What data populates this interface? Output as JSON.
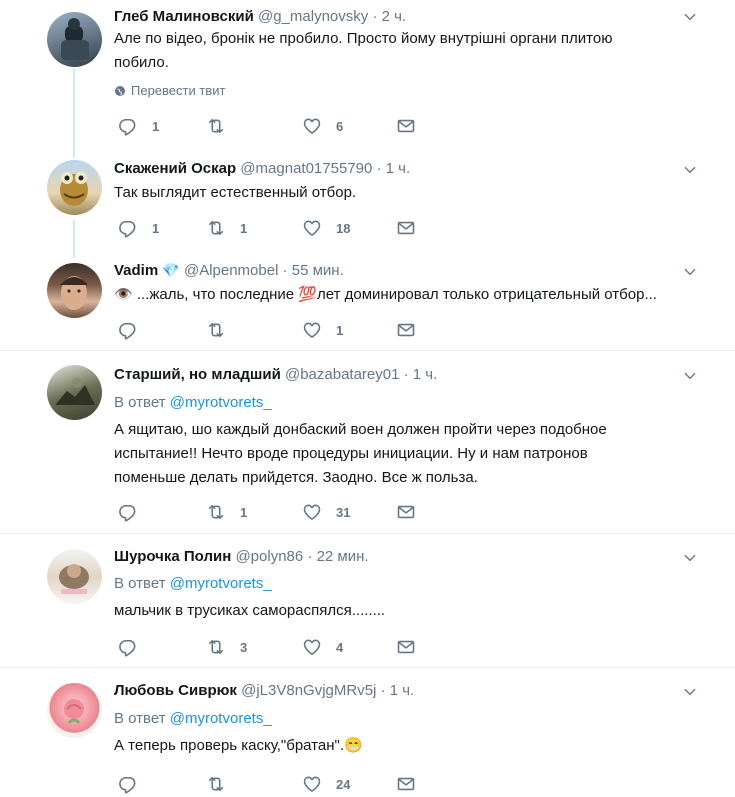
{
  "tweets": [
    {
      "name": "Глеб Малиновский",
      "handle": "@g_malynovsky",
      "time": "· 2 ч.",
      "text_lines": [
        "Але по відео, бронік не пробило. Просто йому внутрішні органи плитою",
        "побило."
      ],
      "translate": "Перевести твит",
      "replies": "1",
      "retweets": "",
      "likes": "6"
    },
    {
      "name": "Скажений Оскар",
      "handle": "@magnat01755790",
      "time": "· 1 ч.",
      "text_lines": [
        "Так выглядит естественный отбор."
      ],
      "replies": "1",
      "retweets": "1",
      "likes": "18"
    },
    {
      "name": "Vadim",
      "badge": "💎",
      "handle": "@Alpenmobel",
      "time": "· 55 мин.",
      "text_prefix": "👁️ ...жаль, что последние ",
      "text_emoji": "💯",
      "text_suffix": "лет доминировал только отрицательный отбор...",
      "replies": "",
      "retweets": "",
      "likes": "1"
    },
    {
      "name": "Старший, но младший",
      "handle": "@bazabatarey01",
      "time": "· 1 ч.",
      "reply_prefix": "В ответ",
      "reply_to": "@myrotvorets_",
      "text_lines": [
        "А ящитаю, шо каждый донбаский воен должен пройти через подобное",
        "испытание!! Нечто вроде процедуры инициации. Ну и нам патронов",
        "поменьше делать прийдется. Заодно. Все ж польза."
      ],
      "replies": "",
      "retweets": "1",
      "likes": "31"
    },
    {
      "name": "Шурочка Полин",
      "handle": "@polyn86",
      "time": "· 22 мин.",
      "reply_prefix": "В ответ",
      "reply_to": "@myrotvorets_",
      "text_lines": [
        "мальчик в трусиках самораспялся........"
      ],
      "replies": "",
      "retweets": "3",
      "likes": "4"
    },
    {
      "name": "Любовь Сиврюк",
      "handle": "@jL3V8nGvjgMRv5j",
      "time": "· 1 ч.",
      "reply_prefix": "В ответ",
      "reply_to": "@myrotvorets_",
      "text_main": "А теперь проверь каску,\"братан\".",
      "text_emoji": "😁",
      "replies": "",
      "retweets": "",
      "likes": "24"
    }
  ],
  "colors": {
    "accent": "#1b95e0",
    "muted": "#657786",
    "text": "#14171a",
    "thread": "#cfe9fa",
    "divider": "#e6ecf0"
  },
  "icons": [
    "reply-icon",
    "retweet-icon",
    "like-icon",
    "message-icon",
    "chevron-down-icon",
    "globe-icon"
  ]
}
